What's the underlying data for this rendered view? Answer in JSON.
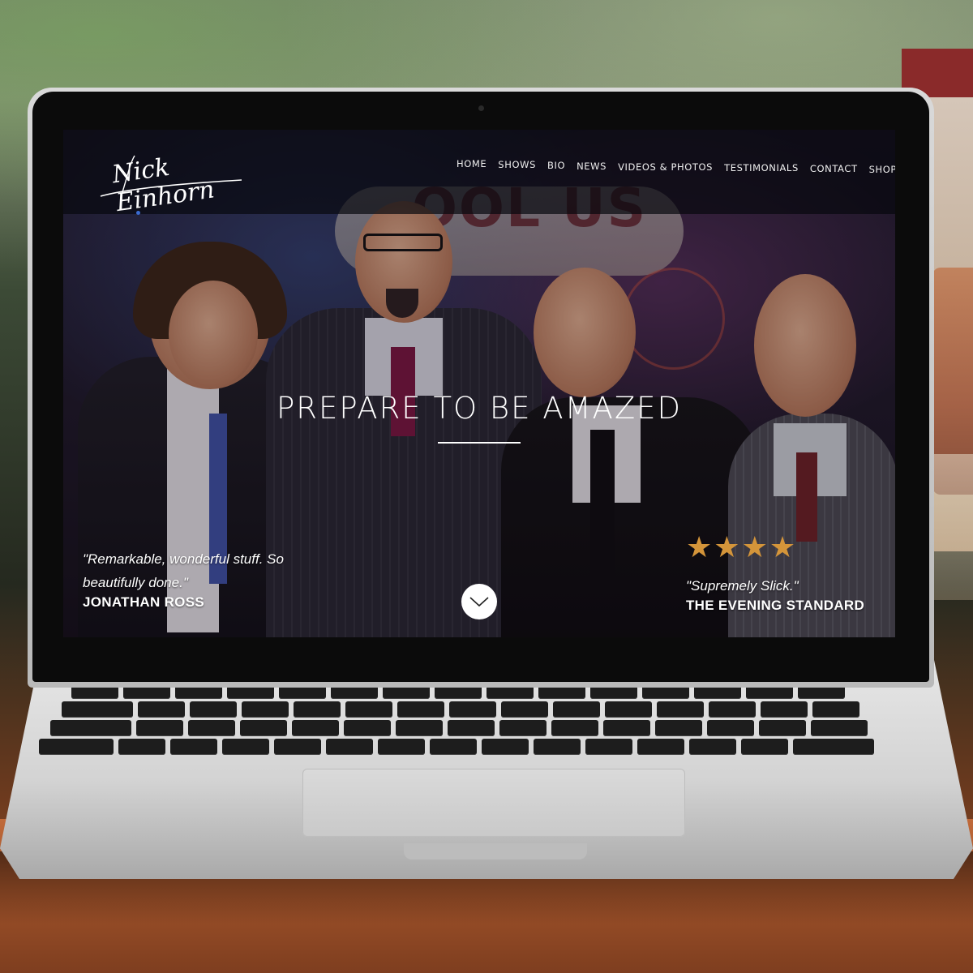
{
  "site": {
    "logo_text": "Nick Einhorn",
    "nav": [
      "HOME",
      "SHOWS",
      "BIO",
      "NEWS",
      "VIDEOS & PHOTOS",
      "TESTIMONIALS",
      "CONTACT",
      "SHOP"
    ]
  },
  "backdrop": {
    "sign_text": "OOL US"
  },
  "hero": {
    "title": "PREPARE TO BE AMAZED"
  },
  "testimonials": {
    "left": {
      "quote": "\"Remarkable, wonderful stuff. So beautifully done.\"",
      "source": "JONATHAN ROSS"
    },
    "right": {
      "rating": 4,
      "quote": "\"Supremely Slick.\"",
      "source": "THE EVENING STANDARD"
    }
  },
  "scroll_icon": "chevron-down-icon",
  "colors": {
    "star": "#d4953a",
    "nav_text": "#f0f0f0",
    "link_dot": "#3a6bd0"
  }
}
